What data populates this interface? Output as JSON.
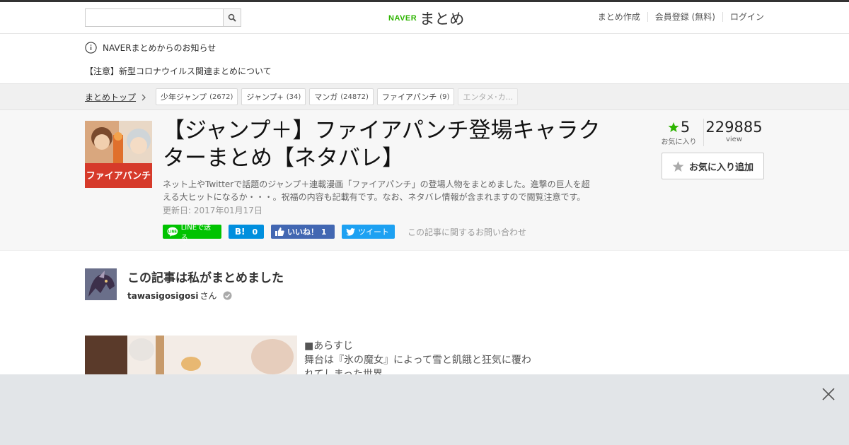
{
  "header": {
    "search_placeholder": "",
    "logo_brand": "NAVER",
    "logo_text": "まとめ",
    "nav": [
      "まとめ作成",
      "会員登録 (無料)",
      "ログイン"
    ]
  },
  "notice": {
    "title": "NAVERまとめからのお知らせ",
    "item": "【注意】新型コロナウイルス関連まとめについて"
  },
  "categories": {
    "home": "まとめトップ",
    "tags": [
      {
        "label": "少年ジャンプ",
        "count": "(2672)"
      },
      {
        "label": "ジャンプ+",
        "count": "(34)"
      },
      {
        "label": "マンガ",
        "count": "(24872)"
      },
      {
        "label": "ファイアパンチ",
        "count": "(9)"
      },
      {
        "label": "エンタメ･カ...",
        "count": ""
      }
    ]
  },
  "article": {
    "thumb_text": "ファイアパンチ",
    "title": "【ジャンプ＋】ファイアパンチ登場キャラクターまとめ【ネタバレ】",
    "description": "ネット上やTwitterで話題のジャンプ＋連載漫画「ファイアパンチ」の登場人物をまとめました。進撃の巨人を超える大ヒットになるか・・・。祝福の内容も記載有です。なお、ネタバレ情報が含まれますので閲覧注意です。",
    "updated": "更新日: 2017年01月17日",
    "share": {
      "line": "LINEで送る",
      "hatena_count": "0",
      "fb_label": "いいね！ 1",
      "tweet": "ツイート",
      "contact": "この記事に関するお問い合わせ"
    },
    "stats": {
      "fav_count": "5",
      "fav_label": "お気に入り",
      "view_count": "229885",
      "view_label": "view"
    },
    "fav_button": "お気に入り追加"
  },
  "author": {
    "heading": "この記事は私がまとめました",
    "name": "tawasigosigosi",
    "suffix": "さん"
  },
  "content": {
    "lines": [
      "■あらすじ",
      "舞台は『氷の魔女』によって雪と飢餓と狂気に覆わ",
      "れてしまった世界"
    ]
  },
  "colors": {
    "naver_green": "#2db400",
    "line_green": "#00c300",
    "hatena_blue": "#008fde",
    "facebook_blue": "#4267b2",
    "twitter_blue": "#1da1f2",
    "star_green": "#2db400"
  }
}
